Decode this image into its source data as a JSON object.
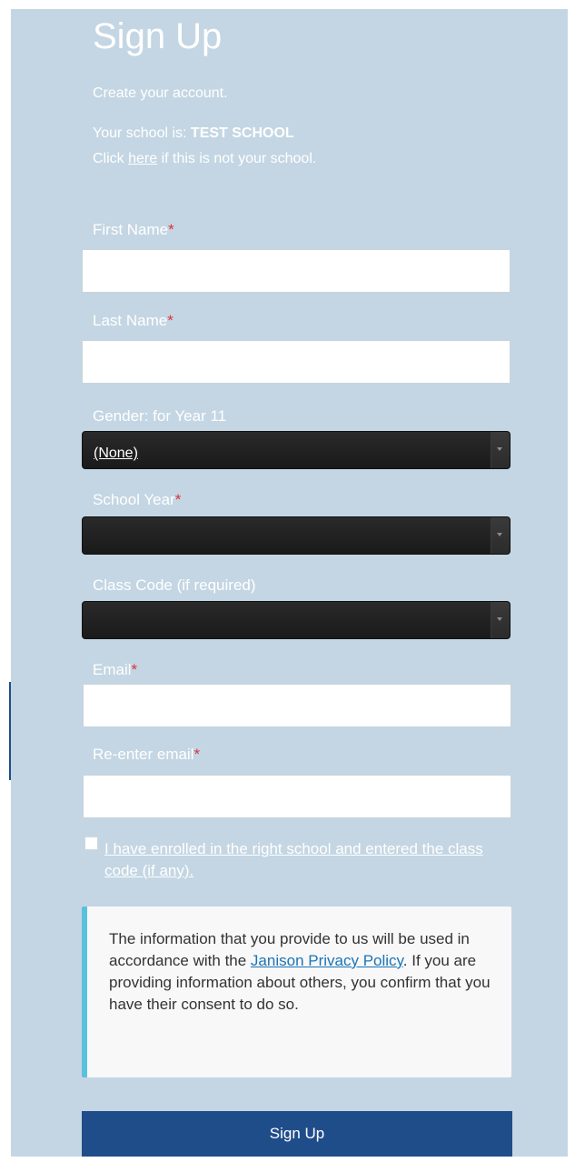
{
  "header": {
    "title": "Sign Up",
    "subtitle": "Create your account."
  },
  "school": {
    "prefix": "Your school is: ",
    "name": "TEST SCHOOL",
    "click_prefix": "Click ",
    "link": "here",
    "click_suffix": " if this is not your school."
  },
  "form": {
    "first_name_label": "First Name",
    "last_name_label": "Last Name",
    "gender_label": "Gender: for Year 11",
    "gender_value": "(None)",
    "school_year_label": "School Year",
    "school_year_value": "",
    "class_code_label": "Class Code (if required)",
    "class_code_value": "",
    "email_label": "Email",
    "reenter_email_label": "Re-enter email",
    "required_mark": "*",
    "first_name_value": "",
    "last_name_value": "",
    "email_value": "",
    "reenter_email_value": ""
  },
  "agreement": {
    "checked": false,
    "label": "I have enrolled in the right school and entered the class code (if any)."
  },
  "privacy": {
    "text_before": "The information that you provide to us will be used in accordance with the ",
    "link": "Janison Privacy Policy",
    "text_after": ". If you are providing information about others, you confirm that you have their consent to do so."
  },
  "submit_label": "Sign Up",
  "colors": {
    "panel_bg": "#c4d6e3",
    "required": "#d9333a",
    "button_bg": "#1f4d89",
    "info_border": "#5bc0de",
    "link": "#1a75b8"
  }
}
